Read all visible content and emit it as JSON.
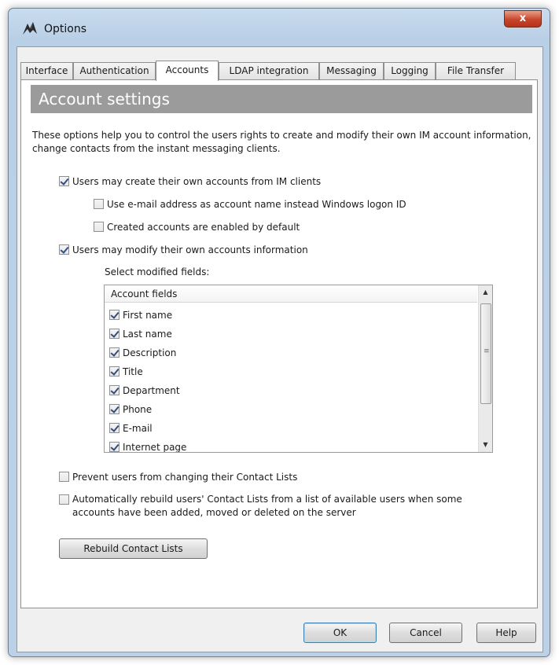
{
  "window": {
    "title": "Options",
    "close_glyph": "x"
  },
  "tabs": [
    {
      "label": "Interface",
      "active": false
    },
    {
      "label": "Authentication",
      "active": false
    },
    {
      "label": "Accounts",
      "active": true
    },
    {
      "label": "LDAP integration",
      "active": false
    },
    {
      "label": "Messaging",
      "active": false
    },
    {
      "label": "Logging",
      "active": false
    },
    {
      "label": "File Transfer",
      "active": false
    }
  ],
  "panel": {
    "banner": "Account settings",
    "description": "These options help you to control the users rights to create and modify their own IM account information, change contacts from the instant messaging clients.",
    "options": {
      "create_accounts": {
        "label": "Users may create their own accounts from IM clients",
        "checked": true
      },
      "use_email": {
        "label": "Use e-mail address as account name instead Windows logon ID",
        "checked": false
      },
      "enabled_default": {
        "label": "Created accounts are enabled by default",
        "checked": false
      },
      "modify_accounts": {
        "label": "Users may modify their own accounts information",
        "checked": true
      },
      "prevent_changing": {
        "label": "Prevent users from changing their Contact Lists",
        "checked": false
      },
      "auto_rebuild": {
        "label": "Automatically rebuild users' Contact Lists from a list of available users when some accounts have been added, moved or deleted on the server",
        "checked": false
      }
    },
    "select_fields_label": "Select modified fields:",
    "fields_header": "Account fields",
    "fields": [
      {
        "label": "First name",
        "checked": true
      },
      {
        "label": "Last name",
        "checked": true
      },
      {
        "label": "Description",
        "checked": true
      },
      {
        "label": "Title",
        "checked": true
      },
      {
        "label": "Department",
        "checked": true
      },
      {
        "label": "Phone",
        "checked": true
      },
      {
        "label": "E-mail",
        "checked": true
      },
      {
        "label": "Internet page",
        "checked": true
      }
    ],
    "rebuild_button": "Rebuild Contact Lists"
  },
  "buttons": {
    "ok": "OK",
    "cancel": "Cancel",
    "help": "Help"
  },
  "colors": {
    "banner_bg": "#9b9b9b",
    "close_red": "#c7452b",
    "window_frame": "#bdd1e6"
  }
}
